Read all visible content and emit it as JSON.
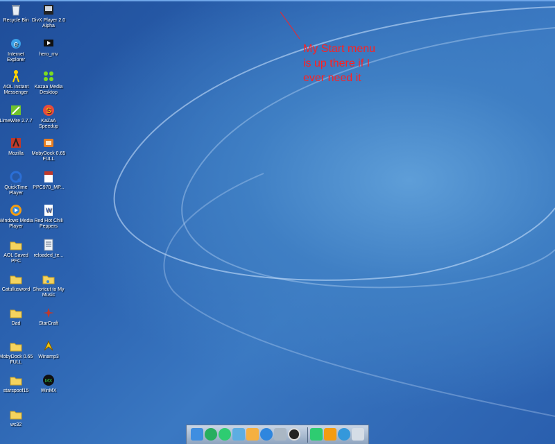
{
  "annotation": {
    "line1": "My Start menu",
    "line2": "is up there if I",
    "line3": "ever need it",
    "color": "#ff2020"
  },
  "desktop": {
    "col1": [
      {
        "label": "Recycle Bin",
        "icon": "recycle-bin-icon"
      },
      {
        "label": "Internet Explorer",
        "icon": "internet-explorer-icon"
      },
      {
        "label": "AOL Instant Messenger",
        "icon": "aim-icon"
      },
      {
        "label": "LimeWire 2.7.7",
        "icon": "limewire-icon"
      },
      {
        "label": "Mozilla",
        "icon": "mozilla-icon"
      },
      {
        "label": "QuickTime Player",
        "icon": "quicktime-icon"
      },
      {
        "label": "Windows Media Player",
        "icon": "media-player-icon"
      },
      {
        "label": "AOL Saved PFC",
        "icon": "folder-icon"
      },
      {
        "label": "Catullusword",
        "icon": "folder-icon"
      },
      {
        "label": "Dad",
        "icon": "folder-icon"
      },
      {
        "label": "MobyDock 0.65 FULL",
        "icon": "folder-icon"
      },
      {
        "label": "starspoof15",
        "icon": "folder-icon"
      },
      {
        "label": "wc32",
        "icon": "folder-icon"
      }
    ],
    "col2": [
      {
        "label": "DivX Player 2.0 Alpha",
        "icon": "divx-player-icon"
      },
      {
        "label": "hero_mv",
        "icon": "video-file-icon"
      },
      {
        "label": "Kazaa Media Desktop",
        "icon": "kazaa-icon"
      },
      {
        "label": "KaZaA Speedup",
        "icon": "kazaa-speedup-icon"
      },
      {
        "label": "MobyDock 0.65 FULL",
        "icon": "mobydock-icon"
      },
      {
        "label": "PPC970_MP...",
        "icon": "pdf-file-icon"
      },
      {
        "label": "Red Hot Chili Peppers",
        "icon": "word-document-icon"
      },
      {
        "label": "reloaded_te...",
        "icon": "text-file-icon"
      },
      {
        "label": "Shortcut to My Music",
        "icon": "music-folder-icon"
      },
      {
        "label": "StarCraft",
        "icon": "starcraft-icon"
      },
      {
        "label": "Winamp3",
        "icon": "winamp-icon"
      },
      {
        "label": "WinMX",
        "icon": "winmx-icon"
      }
    ]
  },
  "dock": {
    "items": [
      "desktop-icon",
      "ie-icon",
      "globe-e-icon",
      "mail-icon",
      "photos-icon",
      "globe-icon",
      "network-icon",
      "media-icon",
      "documents-icon",
      "tools-icon",
      "clock-icon",
      "system-icon"
    ]
  }
}
